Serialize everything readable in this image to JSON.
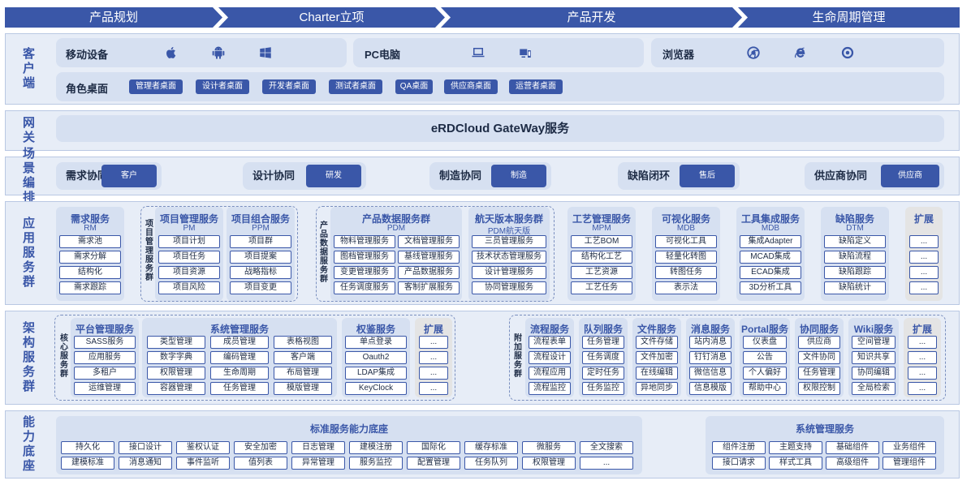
{
  "phases": [
    "产品规划",
    "Charter立项",
    "产品开发",
    "生命周期管理"
  ],
  "layers": {
    "client": "客户端",
    "gateway": "网关",
    "scene": "场景编排",
    "app": "应用服务群",
    "arch": "架构服务群",
    "base": "能力底座"
  },
  "client": {
    "mobile_label": "移动设备",
    "pc_label": "PC电脑",
    "browser_label": "浏览器",
    "desk_label": "角色桌面",
    "desks": [
      "管理者桌面",
      "设计者桌面",
      "开发者桌面",
      "测试者桌面",
      "QA桌面",
      "供应商桌面",
      "运营者桌面"
    ]
  },
  "gateway": {
    "title": "eRDCloud GateWay服务"
  },
  "scene": [
    {
      "label": "需求协同",
      "tag": "客户"
    },
    {
      "label": "设计协同",
      "tag": "研发"
    },
    {
      "label": "制造协同",
      "tag": "制造"
    },
    {
      "label": "缺陷闭环",
      "tag": "售后"
    },
    {
      "label": "供应商协同",
      "tag": "供应商"
    }
  ],
  "app": {
    "rm": {
      "title": "需求服务",
      "sub": "RM",
      "items": [
        "需求池",
        "需求分解",
        "结构化",
        "需求跟踪"
      ]
    },
    "project_label": "项目管理服务群",
    "pm": {
      "title": "项目管理服务",
      "sub": "PM",
      "items": [
        "项目计划",
        "项目任务",
        "项目资源",
        "项目风险"
      ]
    },
    "ppm": {
      "title": "项目组合服务",
      "sub": "PPM",
      "items": [
        "项目群",
        "项目提案",
        "战略指标",
        "项目变更"
      ]
    },
    "pdm_label": "产品数据服务群",
    "pdm": {
      "title": "产品数据服务群",
      "sub": "PDM",
      "left": [
        "物料管理服务",
        "图档管理服务",
        "变更管理服务",
        "任务调度服务"
      ],
      "right": [
        "文档管理服务",
        "基线管理服务",
        "产品数据服务",
        "客制扩展服务"
      ]
    },
    "aero": {
      "title": "航天版本服务群",
      "sub": "PDM航天版",
      "items": [
        "三员管理服务",
        "技术状态管理服务",
        "设计管理服务",
        "协同管理服务"
      ]
    },
    "mpm": {
      "title": "工艺管理服务",
      "sub": "MPM",
      "items": [
        "工艺BOM",
        "结构化工艺",
        "工艺资源",
        "工艺任务"
      ]
    },
    "mdb": {
      "title": "可视化服务",
      "sub": "MDB",
      "items": [
        "可视化工具",
        "轻量化转图",
        "转图任务",
        "表示法"
      ]
    },
    "tool": {
      "title": "工具集成服务",
      "sub": "MDB",
      "items": [
        "集成Adapter",
        "MCAD集成",
        "ECAD集成",
        "3D分析工具"
      ]
    },
    "dtm": {
      "title": "缺陷服务",
      "sub": "DTM",
      "items": [
        "缺陷定义",
        "缺陷流程",
        "缺陷跟踪",
        "缺陷统计"
      ]
    },
    "expand": {
      "title": "扩展",
      "items": [
        "...",
        "...",
        "...",
        "..."
      ]
    }
  },
  "arch": {
    "core_label": "核心服务群",
    "platform": {
      "title": "平台管理服务",
      "items": [
        "SASS服务",
        "应用服务",
        "多租户",
        "运维管理"
      ]
    },
    "system": {
      "title": "系统管理服务",
      "rows": [
        [
          "类型管理",
          "成员管理",
          "表格视图"
        ],
        [
          "数字字典",
          "编码管理",
          "客户端"
        ],
        [
          "权限管理",
          "生命周期",
          "布局管理"
        ],
        [
          "容器管理",
          "任务管理",
          "模版管理"
        ]
      ]
    },
    "auth": {
      "title": "权鉴服务",
      "items": [
        "单点登录",
        "Oauth2",
        "LDAP集成",
        "KeyClock"
      ]
    },
    "expand1": {
      "title": "扩展",
      "items": [
        "...",
        "...",
        "...",
        "..."
      ]
    },
    "addon_label": "附加服务群",
    "flow": {
      "title": "流程服务",
      "items": [
        "流程表单",
        "流程设计",
        "流程应用",
        "流程监控"
      ]
    },
    "queue": {
      "title": "队列服务",
      "items": [
        "任务管理",
        "任务调度",
        "定时任务",
        "任务监控"
      ]
    },
    "file": {
      "title": "文件服务",
      "items": [
        "文件存储",
        "文件加密",
        "在线编辑",
        "异地同步"
      ]
    },
    "msg": {
      "title": "消息服务",
      "items": [
        "站内消息",
        "钉钉消息",
        "微信信息",
        "信息模版"
      ]
    },
    "portal": {
      "title": "Portal服务",
      "items": [
        "仪表盘",
        "公告",
        "个人偏好",
        "帮助中心"
      ]
    },
    "collab": {
      "title": "协同服务",
      "items": [
        "供应商",
        "文件协同",
        "任务管理",
        "权限控制"
      ]
    },
    "wiki": {
      "title": "Wiki服务",
      "items": [
        "空间管理",
        "知识共享",
        "协同编辑",
        "全局检索"
      ]
    },
    "expand2": {
      "title": "扩展",
      "items": [
        "...",
        "...",
        "...",
        "..."
      ]
    }
  },
  "base": {
    "std": {
      "title": "标准服务能力底座",
      "row1": [
        "持久化",
        "接口设计",
        "鉴权认证",
        "安全加密",
        "日志管理",
        "建模注册",
        "国际化",
        "缓存标准",
        "微服务",
        "全文搜索"
      ],
      "row2": [
        "建模标准",
        "消息通知",
        "事件监听",
        "值列表",
        "异常管理",
        "服务监控",
        "配置管理",
        "任务队列",
        "权限管理",
        "..."
      ]
    },
    "sys": {
      "title": "系统管理服务",
      "row1": [
        "组件注册",
        "主题支持",
        "基础组件",
        "业务组件"
      ],
      "row2": [
        "接口请求",
        "样式工具",
        "高级组件",
        "管理组件"
      ]
    }
  },
  "colors": {
    "accent": "#3a57a8",
    "layer_bg": "#e7edf7",
    "panel_bg": "#d6e0f1",
    "expand_bg": "#e4e4e4"
  },
  "icons": [
    "apple-icon",
    "android-icon",
    "windows-icon",
    "laptop-icon",
    "desktop-mobile-icon",
    "chrome-icon",
    "ie-icon",
    "edge-icon"
  ]
}
